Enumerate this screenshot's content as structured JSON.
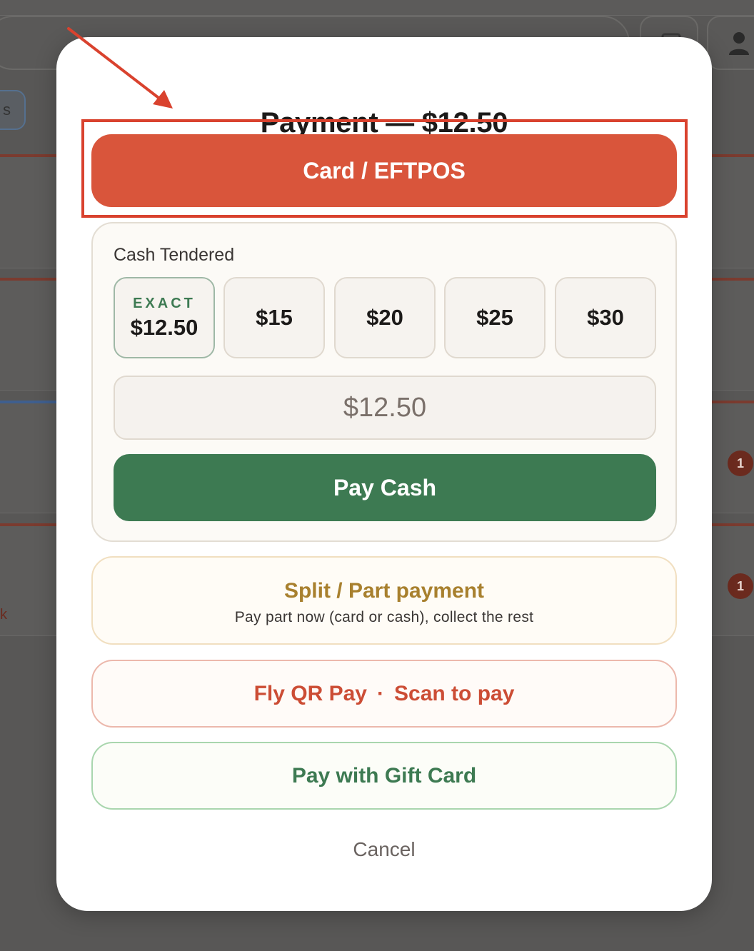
{
  "modal": {
    "title": "Payment — $12.50",
    "card_button": "Card / EFTPOS",
    "cash": {
      "label": "Cash Tendered",
      "quick_amounts": [
        {
          "tag": "EXACT",
          "value": "$12.50"
        },
        {
          "value": "$15"
        },
        {
          "value": "$20"
        },
        {
          "value": "$25"
        },
        {
          "value": "$30"
        }
      ],
      "input_value": "$12.50",
      "pay_button": "Pay Cash"
    },
    "split": {
      "title": "Split / Part payment",
      "subtitle": "Pay part now (card or cash), collect the rest"
    },
    "qr": {
      "label": "Fly QR Pay",
      "separator": "·",
      "sublabel": "Scan to pay"
    },
    "gift_button": "Pay with Gift Card",
    "cancel": "Cancel"
  },
  "background": {
    "pill_text": "s",
    "badges": [
      "1",
      "1"
    ],
    "edge_letter": "k"
  },
  "colors": {
    "card_button": "#d9553b",
    "pay_cash": "#3d7a52",
    "split_title": "#a8802e",
    "qr_text": "#cc4d35",
    "gift_text": "#3d7a52",
    "annotation": "#d9422e"
  },
  "icons": {
    "user": "user-icon",
    "cart": "cart-icon"
  }
}
